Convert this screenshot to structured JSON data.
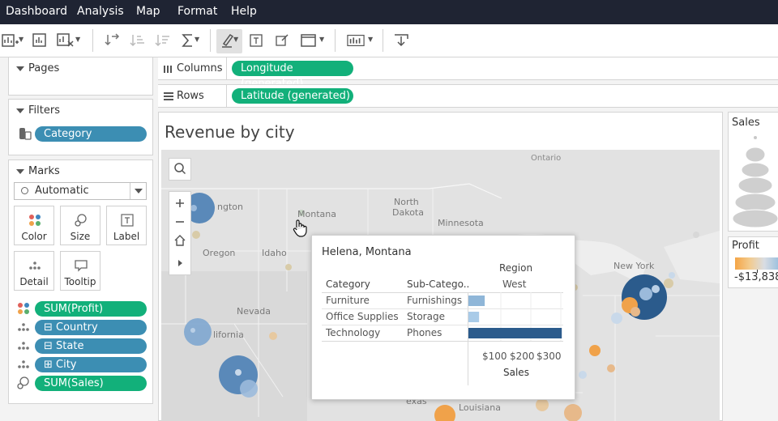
{
  "menu": [
    {
      "label": "Dashboard"
    },
    {
      "label": "Analysis"
    },
    {
      "label": "Map"
    },
    {
      "label": "Format"
    },
    {
      "label": "Help"
    }
  ],
  "panels": {
    "pages": {
      "title": "Pages"
    },
    "filters": {
      "title": "Filters",
      "pills": [
        {
          "label": "Category"
        }
      ]
    },
    "marks": {
      "title": "Marks",
      "mark_type": "Automatic",
      "buttons": [
        {
          "label": "Color"
        },
        {
          "label": "Size"
        },
        {
          "label": "Label"
        },
        {
          "label": "Detail"
        },
        {
          "label": "Tooltip"
        }
      ],
      "fields": [
        {
          "label": "SUM(Profit)"
        },
        {
          "label": "⊟ Country"
        },
        {
          "label": "⊟ State"
        },
        {
          "label": "⊞ City"
        },
        {
          "label": "SUM(Sales)"
        }
      ]
    }
  },
  "shelves": {
    "columns": {
      "label": "Columns",
      "pill": "Longitude (generated)"
    },
    "rows": {
      "label": "Rows",
      "pill": "Latitude (generated)"
    }
  },
  "worksheet": {
    "title": "Revenue by city"
  },
  "map": {
    "labels": [
      "Ontario",
      "North Dakota",
      "Minnesota",
      "Montana",
      "Oregon",
      "Idaho",
      "Nevada",
      "California",
      "Texas",
      "Louisiana",
      "New York",
      "Washington"
    ],
    "label_texts": {
      "ontario": "Ontario",
      "north": "North",
      "dakota": "Dakota",
      "minnesota": "Minnesota",
      "montana": "Montana",
      "oregon": "Oregon",
      "idaho": "Idaho",
      "nevada": "Nevada",
      "california": "lifornia",
      "texas": "exas",
      "louisiana": "Louisiana",
      "newyork": "New York",
      "washington": "ngton"
    }
  },
  "tooltip": {
    "title": "Helena, Montana",
    "region_header": "Region",
    "region_value": "West",
    "col_category": "Category",
    "col_subcategory": "Sub-Catego..",
    "rows": [
      {
        "category": "Furniture",
        "subcategory": "Furnishings",
        "sales": 55
      },
      {
        "category": "Office Supplies",
        "subcategory": "Storage",
        "sales": 36
      },
      {
        "category": "Technology",
        "subcategory": "Phones",
        "sales": 315
      }
    ],
    "axis_ticks": [
      "$100",
      "$200",
      "$300"
    ],
    "axis_label": "Sales"
  },
  "legends": {
    "sales": {
      "title": "Sales"
    },
    "profit": {
      "title": "Profit",
      "min_label": "-$13,838"
    }
  },
  "colors": {
    "menubar": "#1f2433",
    "pill_green": "#12b07a",
    "pill_teal": "#3c8eb3",
    "bar_dark": "#2b5b8c",
    "bar_light": "#8fb6d8",
    "orange": "#f0a24a",
    "blue": "#4b7fb5"
  }
}
